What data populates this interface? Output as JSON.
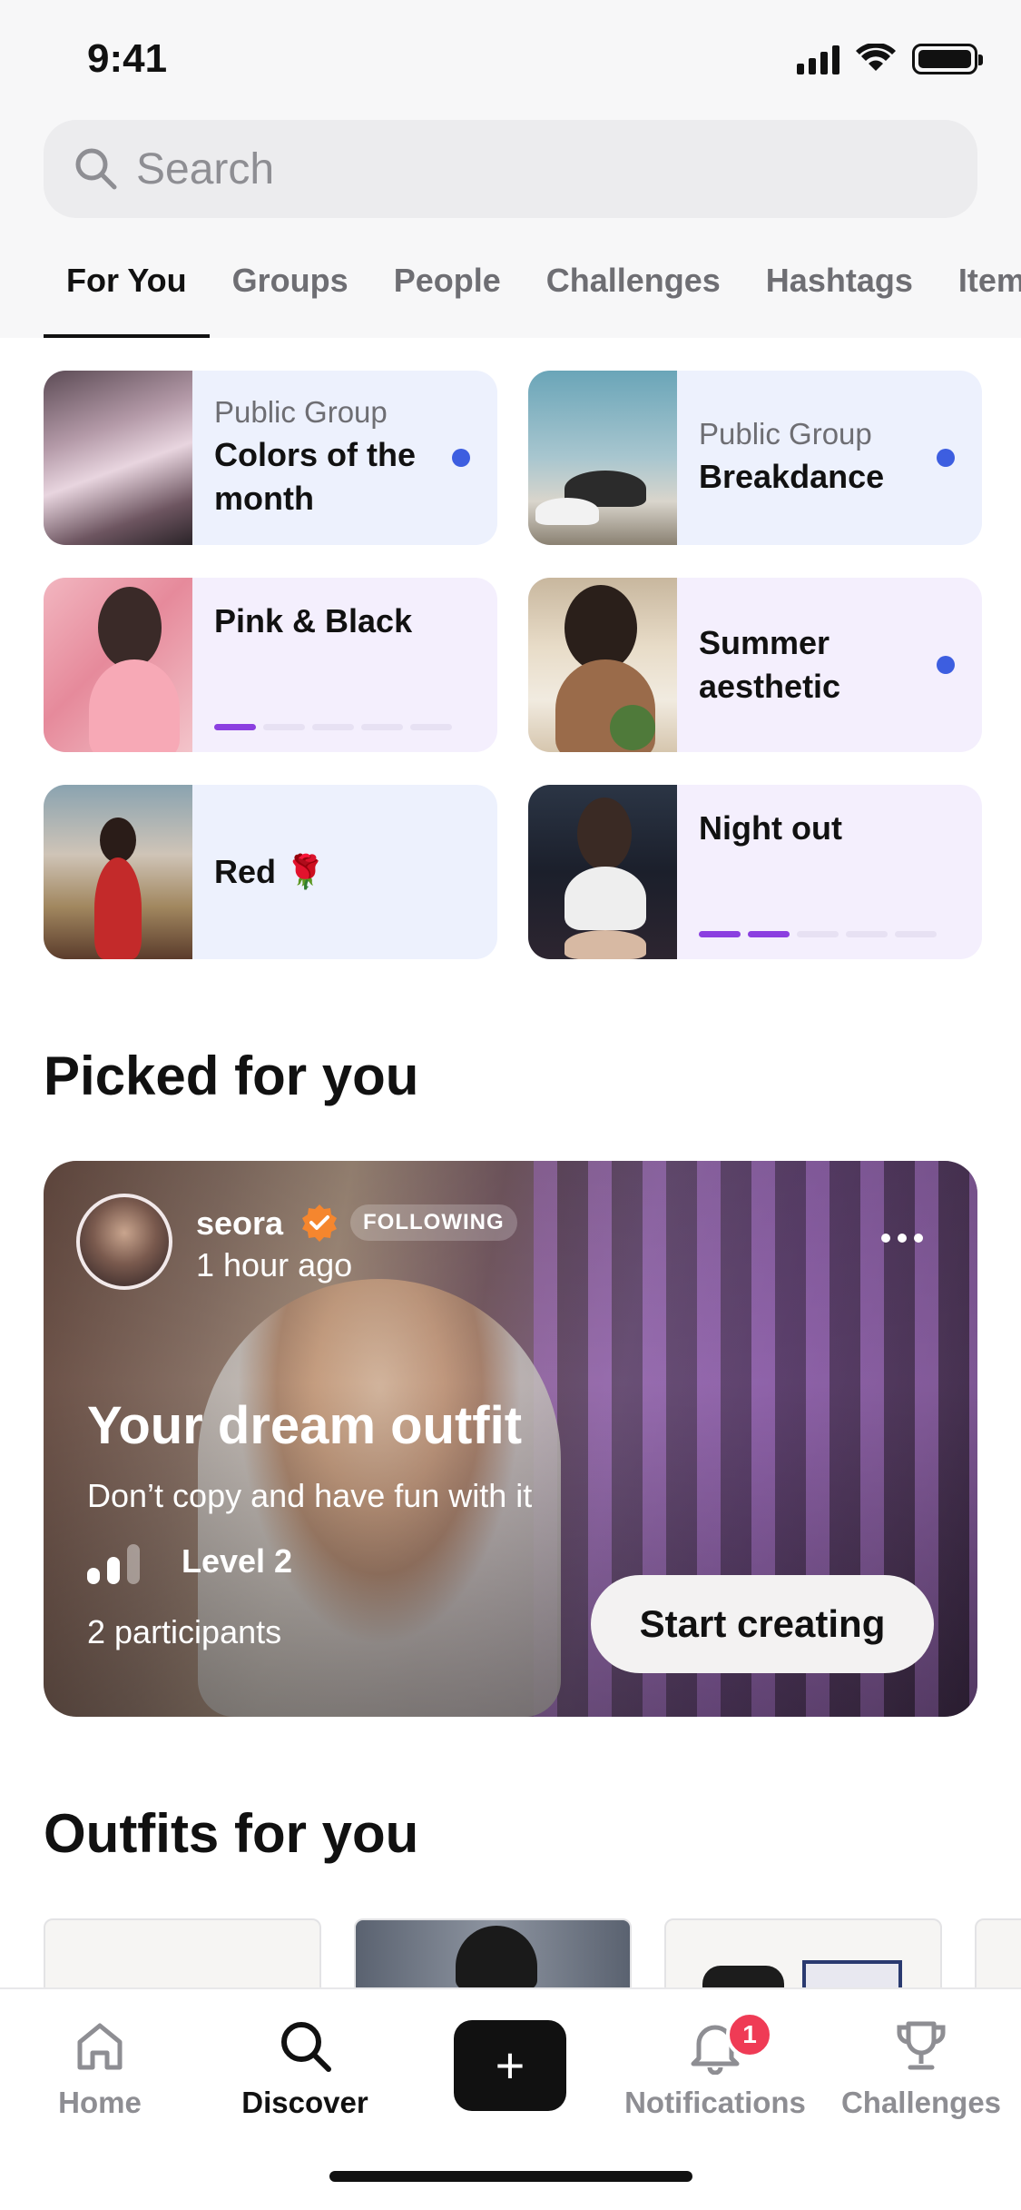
{
  "status_bar": {
    "time": "9:41"
  },
  "search": {
    "placeholder": "Search"
  },
  "tabs": [
    {
      "label": "For You",
      "active": true
    },
    {
      "label": "Groups"
    },
    {
      "label": "People"
    },
    {
      "label": "Challenges"
    },
    {
      "label": "Hashtags"
    },
    {
      "label": "Item"
    }
  ],
  "groups": [
    {
      "type": "Public Group",
      "name": "Colors of the month",
      "unread": true,
      "style": "blue"
    },
    {
      "type": "Public Group",
      "name": "Breakdance",
      "unread": true,
      "style": "blue"
    },
    {
      "type": "",
      "name": "Pink & Black",
      "unread": false,
      "style": "purple",
      "progress": "1/5"
    },
    {
      "type": "",
      "name": "Summer aesthetic",
      "unread": true,
      "style": "purple"
    },
    {
      "type": "",
      "name": "Red 🌹",
      "unread": false,
      "style": "blue"
    },
    {
      "type": "",
      "name": "Night out",
      "unread": false,
      "style": "purple",
      "progress": "2/5"
    }
  ],
  "picked": {
    "section_title": "Picked for you",
    "author": "seora",
    "verified": true,
    "follow_status": "FOLLOWING",
    "time_ago": "1 hour ago",
    "title": "Your dream outfit",
    "subtitle": "Don’t copy and have fun with it",
    "level": "Level 2",
    "level_value": 2,
    "participants": "2 participants",
    "cta": "Start creating"
  },
  "outfits": {
    "section_title": "Outfits for you"
  },
  "tabbar": {
    "home": "Home",
    "discover": "Discover",
    "notifications": "Notifications",
    "notifications_count": "1",
    "challenges": "Challenges",
    "create_label": "+"
  },
  "colors": {
    "accent_blue": "#3d5ee0",
    "accent_purple": "#8b3fe0",
    "badge_red": "#ef3b55",
    "verified_orange": "#f5862e"
  }
}
